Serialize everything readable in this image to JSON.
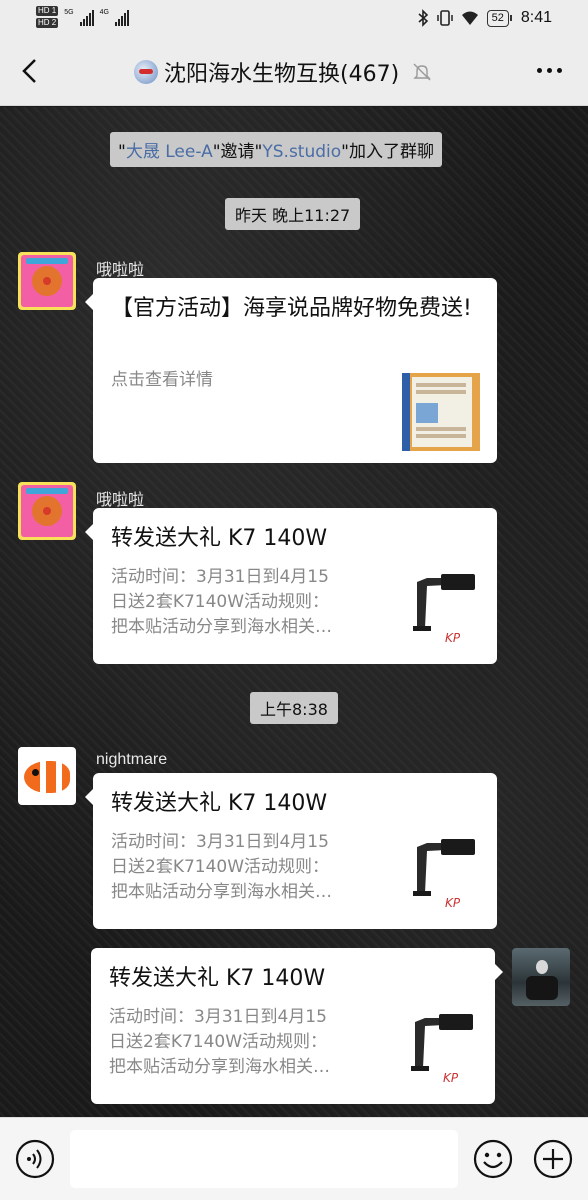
{
  "status_bar": {
    "left_tags": [
      "HD 1",
      "HD 2"
    ],
    "net1": "5G",
    "net2": "4G",
    "battery": "52",
    "time": "8:41"
  },
  "header": {
    "title": "沈阳海水生物互换(467)",
    "icons": [
      "back-icon",
      "group-logo-icon",
      "mute-bell-icon",
      "more-icon"
    ]
  },
  "chat": {
    "system_notice": {
      "quote1": "\"",
      "inviter": "大晟 Lee-A",
      "mid": "\"邀请\"",
      "invitee": "YS.studio",
      "suffix": "\"加入了群聊"
    },
    "time1": "昨天 晚上11:27",
    "time2": "上午8:38",
    "messages": [
      {
        "sender": "哦啦啦",
        "title": "【官方活动】海享说品牌好物免费送!",
        "desc": "点击查看详情"
      },
      {
        "sender": "哦啦啦",
        "title": "转发送大礼 K7 140W",
        "desc_lines": [
          "活动时间：3月31日到4月15",
          "日送2套K7140W活动规则：",
          "把本贴活动分享到海水相关…"
        ]
      },
      {
        "sender": "nightmare",
        "title": "转发送大礼 K7 140W",
        "desc_lines": [
          "活动时间：3月31日到4月15",
          "日送2套K7140W活动规则：",
          "把本贴活动分享到海水相关…"
        ]
      },
      {
        "sender": "",
        "title": "转发送大礼 K7 140W",
        "desc_lines": [
          "活动时间：3月31日到4月15",
          "日送2套K7140W活动规则：",
          "把本贴活动分享到海水相关…"
        ]
      }
    ]
  },
  "input_bar": {
    "icons": [
      "voice-icon",
      "emoji-icon",
      "plus-icon"
    ],
    "value": ""
  },
  "colors": {
    "highlight_name": "#4a6da6",
    "bar_bg": "#ededed",
    "card_bg": "#ffffff",
    "chat_bg": "#1c1c1c"
  }
}
